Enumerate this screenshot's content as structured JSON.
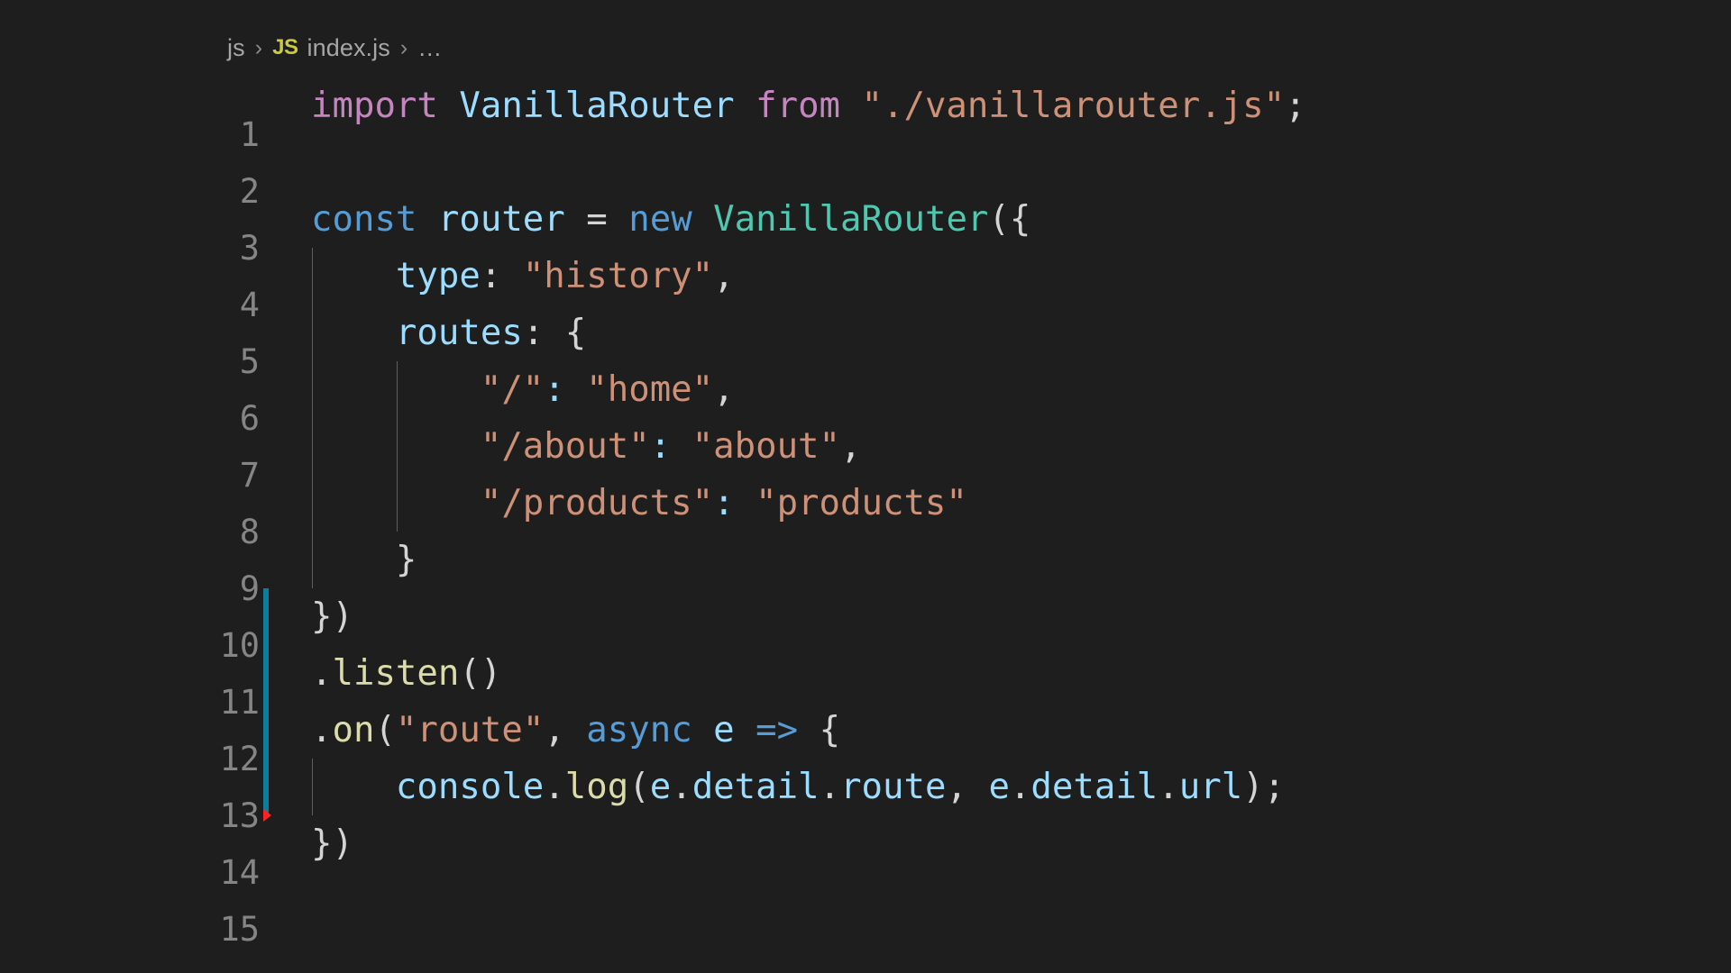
{
  "editor": {
    "background": "#1e1e1e",
    "breadcrumb": {
      "folder": "js",
      "separator": "›",
      "filetype_badge": "JS",
      "filename": "index.js",
      "ellipsis": "…"
    },
    "line_numbers": [
      "1",
      "2",
      "3",
      "4",
      "5",
      "6",
      "7",
      "8",
      "9",
      "10",
      "11",
      "12",
      "13",
      "14",
      "15"
    ],
    "colors": {
      "keyword_import": "#c586c0",
      "keyword_declaration": "#569cd6",
      "class_name": "#4ec9b0",
      "variable": "#9cdcfe",
      "string": "#ce9178",
      "function": "#dcdcaa",
      "punctuation": "#d4d4d4",
      "line_number": "#858585",
      "change_bar_modified": "#0c7d9d",
      "change_bar_deleted": "#ff2222",
      "breadcrumb_text": "#a6a6a6",
      "js_badge": "#cbcb41"
    },
    "lines": [
      {
        "num": "1",
        "indent": 0,
        "change": "none",
        "tokens": [
          {
            "t": "import",
            "c": "t-kw"
          },
          {
            "t": " ",
            "c": "t-plain"
          },
          {
            "t": "VanillaRouter",
            "c": "t-var"
          },
          {
            "t": " ",
            "c": "t-plain"
          },
          {
            "t": "from",
            "c": "t-kw"
          },
          {
            "t": " ",
            "c": "t-plain"
          },
          {
            "t": "\"./vanillarouter.js\"",
            "c": "t-str"
          },
          {
            "t": ";",
            "c": "t-punc"
          }
        ]
      },
      {
        "num": "2",
        "indent": 0,
        "change": "none",
        "tokens": []
      },
      {
        "num": "3",
        "indent": 0,
        "change": "none",
        "tokens": [
          {
            "t": "const",
            "c": "t-kw2"
          },
          {
            "t": " ",
            "c": "t-plain"
          },
          {
            "t": "router",
            "c": "t-var"
          },
          {
            "t": " ",
            "c": "t-plain"
          },
          {
            "t": "=",
            "c": "t-op"
          },
          {
            "t": " ",
            "c": "t-plain"
          },
          {
            "t": "new",
            "c": "t-kw2"
          },
          {
            "t": " ",
            "c": "t-plain"
          },
          {
            "t": "VanillaRouter",
            "c": "t-type"
          },
          {
            "t": "({",
            "c": "t-punc"
          }
        ]
      },
      {
        "num": "4",
        "indent": 1,
        "change": "none",
        "tokens": [
          {
            "t": "    ",
            "c": "t-plain"
          },
          {
            "t": "type",
            "c": "t-var"
          },
          {
            "t": ":",
            "c": "t-punc"
          },
          {
            "t": " ",
            "c": "t-plain"
          },
          {
            "t": "\"history\"",
            "c": "t-str"
          },
          {
            "t": ",",
            "c": "t-punc"
          }
        ]
      },
      {
        "num": "5",
        "indent": 1,
        "change": "none",
        "tokens": [
          {
            "t": "    ",
            "c": "t-plain"
          },
          {
            "t": "routes",
            "c": "t-var"
          },
          {
            "t": ":",
            "c": "t-punc"
          },
          {
            "t": " ",
            "c": "t-plain"
          },
          {
            "t": "{",
            "c": "t-punc"
          }
        ]
      },
      {
        "num": "6",
        "indent": 2,
        "change": "none",
        "tokens": [
          {
            "t": "        ",
            "c": "t-plain"
          },
          {
            "t": "\"/\"",
            "c": "t-str"
          },
          {
            "t": ":",
            "c": "t-var"
          },
          {
            "t": " ",
            "c": "t-plain"
          },
          {
            "t": "\"home\"",
            "c": "t-str"
          },
          {
            "t": ",",
            "c": "t-punc"
          }
        ]
      },
      {
        "num": "7",
        "indent": 2,
        "change": "none",
        "tokens": [
          {
            "t": "        ",
            "c": "t-plain"
          },
          {
            "t": "\"/about\"",
            "c": "t-str"
          },
          {
            "t": ":",
            "c": "t-var"
          },
          {
            "t": " ",
            "c": "t-plain"
          },
          {
            "t": "\"about\"",
            "c": "t-str"
          },
          {
            "t": ",",
            "c": "t-punc"
          }
        ]
      },
      {
        "num": "8",
        "indent": 2,
        "change": "none",
        "tokens": [
          {
            "t": "        ",
            "c": "t-plain"
          },
          {
            "t": "\"/products\"",
            "c": "t-str"
          },
          {
            "t": ":",
            "c": "t-var"
          },
          {
            "t": " ",
            "c": "t-plain"
          },
          {
            "t": "\"products\"",
            "c": "t-str"
          }
        ]
      },
      {
        "num": "9",
        "indent": 1,
        "change": "none",
        "tokens": [
          {
            "t": "    ",
            "c": "t-plain"
          },
          {
            "t": "}",
            "c": "t-punc"
          }
        ]
      },
      {
        "num": "10",
        "indent": 0,
        "change": "modified",
        "tokens": [
          {
            "t": "})",
            "c": "t-punc"
          }
        ]
      },
      {
        "num": "11",
        "indent": 0,
        "change": "modified",
        "tokens": [
          {
            "t": ".",
            "c": "t-punc"
          },
          {
            "t": "listen",
            "c": "t-fn"
          },
          {
            "t": "()",
            "c": "t-punc"
          }
        ]
      },
      {
        "num": "12",
        "indent": 0,
        "change": "modified",
        "tokens": [
          {
            "t": ".",
            "c": "t-punc"
          },
          {
            "t": "on",
            "c": "t-fn"
          },
          {
            "t": "(",
            "c": "t-punc"
          },
          {
            "t": "\"route\"",
            "c": "t-str"
          },
          {
            "t": ",",
            "c": "t-punc"
          },
          {
            "t": " ",
            "c": "t-plain"
          },
          {
            "t": "async",
            "c": "t-kw2"
          },
          {
            "t": " ",
            "c": "t-plain"
          },
          {
            "t": "e",
            "c": "t-var"
          },
          {
            "t": " ",
            "c": "t-plain"
          },
          {
            "t": "=>",
            "c": "t-kw2"
          },
          {
            "t": " ",
            "c": "t-plain"
          },
          {
            "t": "{",
            "c": "t-punc"
          }
        ]
      },
      {
        "num": "13",
        "indent": 1,
        "change": "modified",
        "tokens": [
          {
            "t": "    ",
            "c": "t-plain"
          },
          {
            "t": "console",
            "c": "t-var"
          },
          {
            "t": ".",
            "c": "t-punc"
          },
          {
            "t": "log",
            "c": "t-fn"
          },
          {
            "t": "(",
            "c": "t-punc"
          },
          {
            "t": "e",
            "c": "t-var"
          },
          {
            "t": ".",
            "c": "t-punc"
          },
          {
            "t": "detail",
            "c": "t-var"
          },
          {
            "t": ".",
            "c": "t-punc"
          },
          {
            "t": "route",
            "c": "t-var"
          },
          {
            "t": ",",
            "c": "t-punc"
          },
          {
            "t": " ",
            "c": "t-plain"
          },
          {
            "t": "e",
            "c": "t-var"
          },
          {
            "t": ".",
            "c": "t-punc"
          },
          {
            "t": "detail",
            "c": "t-var"
          },
          {
            "t": ".",
            "c": "t-punc"
          },
          {
            "t": "url",
            "c": "t-var"
          },
          {
            "t": ")",
            "c": "t-punc"
          },
          {
            "t": ";",
            "c": "t-punc"
          }
        ]
      },
      {
        "num": "14",
        "indent": 0,
        "change": "deleted",
        "tokens": [
          {
            "t": "})",
            "c": "t-punc"
          }
        ]
      },
      {
        "num": "15",
        "indent": 0,
        "change": "none",
        "tokens": []
      }
    ]
  }
}
